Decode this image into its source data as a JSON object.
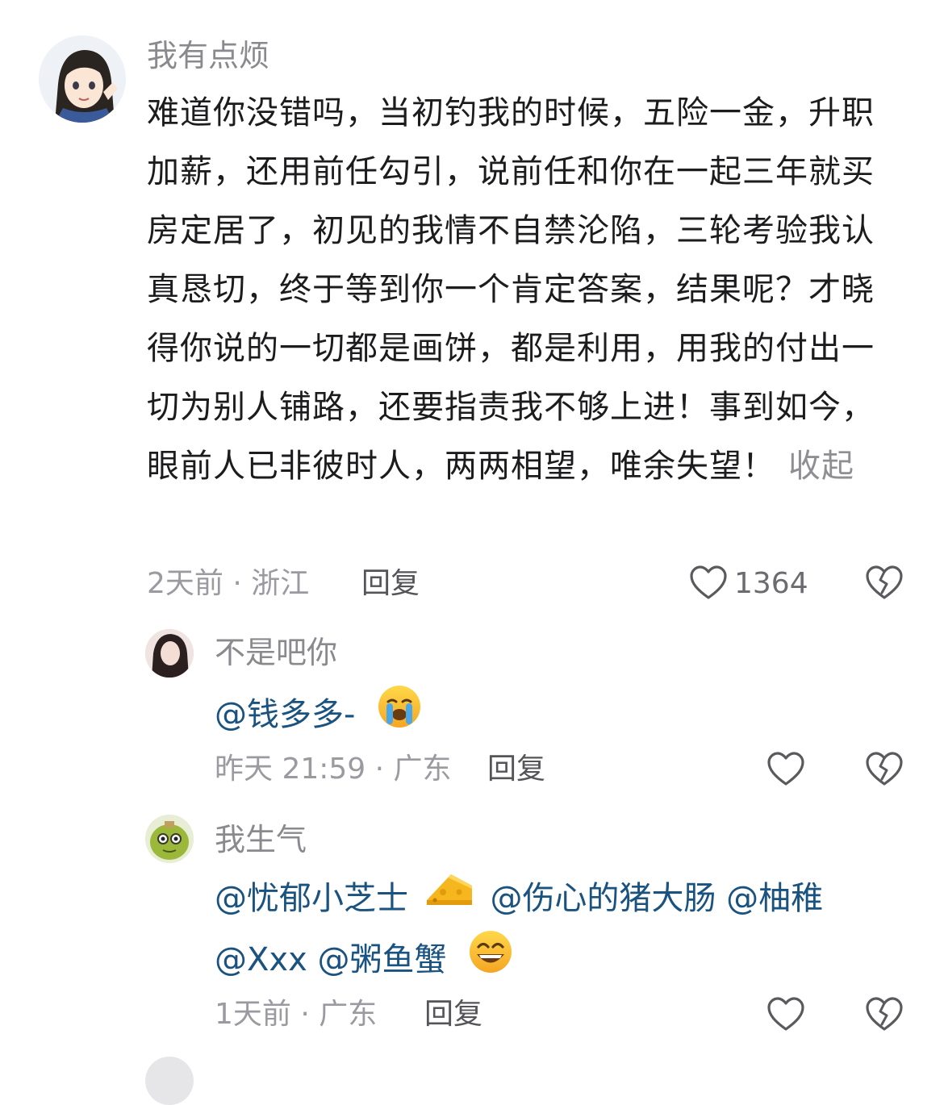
{
  "comment": {
    "username": "我有点烦",
    "body": "难道你没错吗，当初钓我的时候，五险一金，升职加薪，还用前任勾引，说前任和你在一起三年就买房定居了，初见的我情不自禁沦陷，三轮考验我认真恳切，终于等到你一个肯定答案，结果呢？才晓得你说的一切都是画饼，都是利用，用我的付出一切为别人铺路，还要指责我不够上进！事到如今，眼前人已非彼时人，两两相望，唯余失望！",
    "collapse_label": "收起",
    "meta": "2天前 · 浙江",
    "reply_label": "回复",
    "like_count": "1364"
  },
  "replies": [
    {
      "username": "不是吧你",
      "mentions": [
        "@钱多多-"
      ],
      "meta": "昨天 21:59 · 广东",
      "reply_label": "回复"
    },
    {
      "username": "我生气",
      "mentions": [
        "@忧郁小芝士",
        "@伤心的猪大肠",
        "@柚稚",
        "@Xxx",
        "@粥鱼蟹"
      ],
      "meta": "1天前 · 广东",
      "reply_label": "回复"
    }
  ],
  "icons": {
    "like": "heart-outline-icon",
    "dislike": "broken-heart-icon",
    "crying_emoji": "loudly-crying-face-emoji",
    "cheese_emoji": "cheese-emoji",
    "grin_emoji": "grinning-face-emoji"
  },
  "colors": {
    "text": "#1c1c1e",
    "username": "#8a8a8e",
    "meta": "#9a9aa0",
    "mention": "#1a5280",
    "background": "#ffffff"
  }
}
